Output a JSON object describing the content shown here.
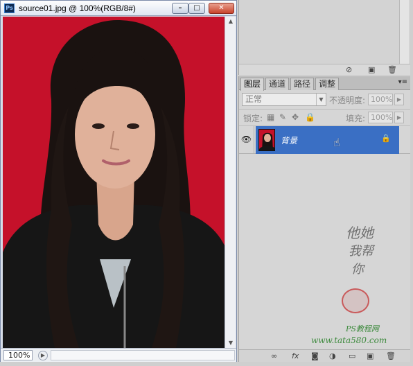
{
  "document": {
    "app_logo": "Ps",
    "title": "source01.jpg @ 100%(RGB/8#)",
    "min_glyph": "–",
    "max_glyph": "□",
    "close_glyph": "✕",
    "zoom": "100%",
    "canvas_background": "#c5112a"
  },
  "layers_panel": {
    "tabs": [
      "图层",
      "通道",
      "路径",
      "调整"
    ],
    "active_tab": "图层",
    "blend_mode": "正常",
    "opacity_label": "不透明度:",
    "opacity_value": "100%",
    "lock_label": "锁定:",
    "fill_label": "填充:",
    "fill_value": "100%",
    "layer": {
      "name": "背景",
      "visible": true,
      "locked": true
    },
    "selection_color": "#3a6fc4"
  },
  "watermark": {
    "line1": "他她",
    "line2": "我帮",
    "line3": "你",
    "site_name": "PS教程网",
    "url": "www.tata580.com"
  },
  "icons": {
    "top_panel": [
      "no-icon",
      "new-icon",
      "trash-icon"
    ],
    "footer": [
      "link-icon",
      "fx-icon",
      "mask-icon",
      "adjustment-icon",
      "group-icon",
      "new-layer-icon",
      "trash-icon"
    ]
  }
}
